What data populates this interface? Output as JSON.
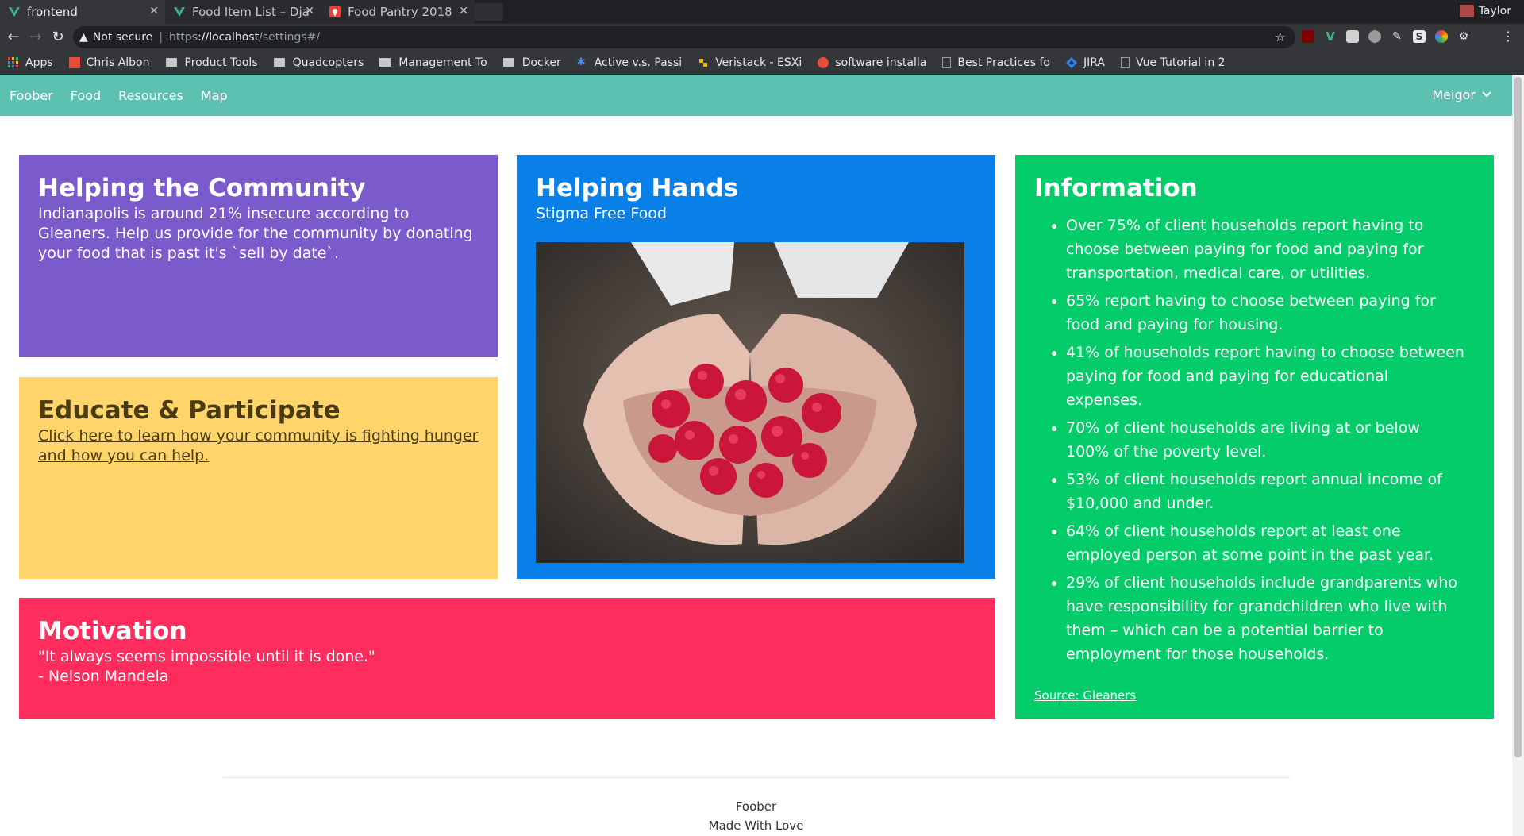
{
  "browser": {
    "tabs": [
      {
        "title": "frontend",
        "icon": "vue-icon",
        "active": true
      },
      {
        "title": "Food Item List – Dja",
        "icon": "vue-icon",
        "active": false
      },
      {
        "title": "Food Pantry 2018",
        "icon": "map-pin-icon",
        "active": false
      }
    ],
    "profile_name": "Taylor",
    "security_label": "Not secure",
    "url_protocol": "https",
    "url_host": "://localhost",
    "url_path": "/settings#/",
    "bookmarks": [
      {
        "label": "Apps",
        "icon": "apps-grid-icon"
      },
      {
        "label": "Chris Albon",
        "icon": "red-square-icon"
      },
      {
        "label": "Product Tools",
        "icon": "folder-icon"
      },
      {
        "label": "Quadcopters",
        "icon": "folder-icon"
      },
      {
        "label": "Management To",
        "icon": "folder-icon"
      },
      {
        "label": "Docker",
        "icon": "folder-icon"
      },
      {
        "label": "Active v.s. Passi",
        "icon": "puzzle-icon"
      },
      {
        "label": "Veristack - ESXi",
        "icon": "vmware-icon"
      },
      {
        "label": "software installa",
        "icon": "ask-icon"
      },
      {
        "label": "Best Practices fo",
        "icon": "page-icon"
      },
      {
        "label": "JIRA",
        "icon": "jira-icon"
      },
      {
        "label": "Vue Tutorial in 2",
        "icon": "page-icon"
      }
    ],
    "colors": {
      "chrome_dark": "#202124",
      "chrome": "#35363a"
    }
  },
  "navbar": {
    "brand": "Foober",
    "links": [
      "Food",
      "Resources",
      "Map"
    ],
    "user": "Meigor",
    "color": "#5cc1b0"
  },
  "cards": {
    "community": {
      "title": "Helping the Community",
      "body": "Indianapolis is around 21% insecure according to Gleaners. Help us provide for the community by donating your food that is past it's `sell by date`.",
      "color": "#7b5bcb"
    },
    "educate": {
      "title": "Educate & Participate",
      "link": "Click here to learn how your community is fighting hunger and how you can help.",
      "color": "#ffd56b"
    },
    "hands": {
      "title": "Helping Hands",
      "subtitle": "Stigma Free Food",
      "image": "hands-holding-raspberries",
      "color": "#0880e8"
    },
    "motivation": {
      "title": "Motivation",
      "quote": "\"It always seems impossible until it is done.\"",
      "author": "- Nelson Mandela",
      "color": "#ff2d5e"
    },
    "info": {
      "title": "Information",
      "items": [
        "Over 75% of client households report having to choose between paying for food and paying for transportation, medical care, or utilities.",
        "65% report having to choose between paying for food and paying for housing.",
        "41% of households report having to choose between paying for food and paying for educational expenses.",
        "70% of client households are living at or below 100% of the poverty level.",
        "53% of client households report annual income of $10,000 and under.",
        "64% of client households report at least one employed person at some point in the past year.",
        "29% of client households include grandparents who have responsibility for grandchildren who live with them – which can be a potential barrier to employment for those households."
      ],
      "source": "Source: Gleaners",
      "color": "#05cc6b"
    }
  },
  "footer": {
    "line1": "Foober",
    "line2": "Made With Love"
  }
}
